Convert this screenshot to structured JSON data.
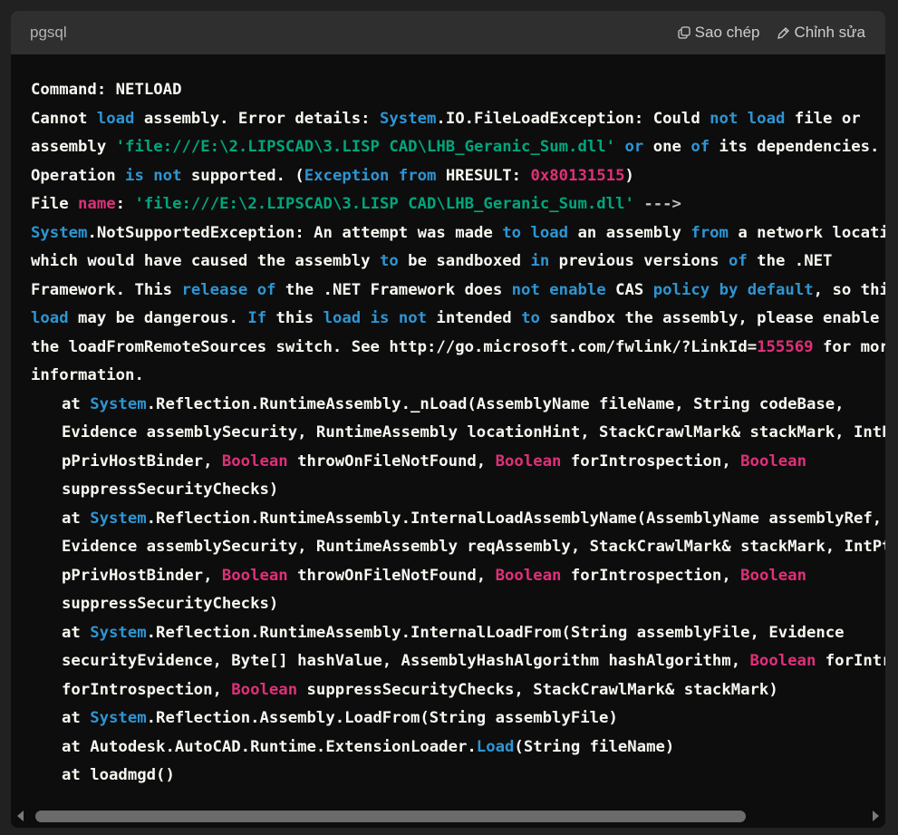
{
  "header": {
    "language": "pgsql",
    "copy_label": "Sao chép",
    "edit_label": "Chỉnh sửa"
  },
  "code_lines": [
    [
      [
        "p",
        "Command: NETLOAD"
      ]
    ],
    [
      [
        "p",
        "Cannot "
      ],
      [
        "kw",
        "load"
      ],
      [
        "p",
        " assembly. Error details: "
      ],
      [
        "kw",
        "System"
      ],
      [
        "p",
        ".IO.FileLoadException: Could "
      ],
      [
        "kw",
        "not"
      ],
      [
        "p",
        " "
      ],
      [
        "kw",
        "load"
      ],
      [
        "p",
        " file or"
      ]
    ],
    [
      [
        "p",
        "assembly "
      ],
      [
        "str",
        "'file:///E:\\2.LIPSCAD\\3.LISP CAD\\LHB_Geranic_Sum.dll'"
      ],
      [
        "p",
        " "
      ],
      [
        "kw",
        "or"
      ],
      [
        "p",
        " one "
      ],
      [
        "kw",
        "of"
      ],
      [
        "p",
        " its dependencies."
      ]
    ],
    [
      [
        "p",
        "Operation "
      ],
      [
        "kw",
        "is"
      ],
      [
        "p",
        " "
      ],
      [
        "kw",
        "not"
      ],
      [
        "p",
        " supported. ("
      ],
      [
        "kw",
        "Exception"
      ],
      [
        "p",
        " "
      ],
      [
        "kw",
        "from"
      ],
      [
        "p",
        " HRESULT: "
      ],
      [
        "num",
        "0x80131515"
      ],
      [
        "p",
        ")"
      ]
    ],
    [
      [
        "p",
        "File "
      ],
      [
        "typ",
        "name"
      ],
      [
        "p",
        ": "
      ],
      [
        "str",
        "'file:///E:\\2.LIPSCAD\\3.LISP CAD\\LHB_Geranic_Sum.dll'"
      ],
      [
        "p",
        " "
      ],
      [
        "op",
        "--->"
      ]
    ],
    [
      [
        "kw",
        "System"
      ],
      [
        "p",
        ".NotSupportedException: An attempt was made "
      ],
      [
        "kw",
        "to"
      ],
      [
        "p",
        " "
      ],
      [
        "kw",
        "load"
      ],
      [
        "p",
        " an assembly "
      ],
      [
        "kw",
        "from"
      ],
      [
        "p",
        " a network location"
      ]
    ],
    [
      [
        "p",
        "which would have caused the assembly "
      ],
      [
        "kw",
        "to"
      ],
      [
        "p",
        " be sandboxed "
      ],
      [
        "kw",
        "in"
      ],
      [
        "p",
        " previous versions "
      ],
      [
        "kw",
        "of"
      ],
      [
        "p",
        " the .NET"
      ]
    ],
    [
      [
        "p",
        "Framework. This "
      ],
      [
        "kw",
        "release"
      ],
      [
        "p",
        " "
      ],
      [
        "kw",
        "of"
      ],
      [
        "p",
        " the .NET Framework does "
      ],
      [
        "kw",
        "not"
      ],
      [
        "p",
        " "
      ],
      [
        "kw",
        "enable"
      ],
      [
        "p",
        " CAS "
      ],
      [
        "kw",
        "policy"
      ],
      [
        "p",
        " "
      ],
      [
        "kw",
        "by"
      ],
      [
        "p",
        " "
      ],
      [
        "kw",
        "default"
      ],
      [
        "p",
        ", so this"
      ]
    ],
    [
      [
        "kw",
        "load"
      ],
      [
        "p",
        " may be dangerous. "
      ],
      [
        "kw",
        "If"
      ],
      [
        "p",
        " this "
      ],
      [
        "kw",
        "load"
      ],
      [
        "p",
        " "
      ],
      [
        "kw",
        "is"
      ],
      [
        "p",
        " "
      ],
      [
        "kw",
        "not"
      ],
      [
        "p",
        " intended "
      ],
      [
        "kw",
        "to"
      ],
      [
        "p",
        " sandbox the assembly, please enable"
      ]
    ],
    [
      [
        "p",
        "the loadFromRemoteSources switch. See http://go.microsoft.com/fwlink/?LinkId="
      ],
      [
        "num",
        "155569"
      ],
      [
        "p",
        " for more"
      ]
    ],
    [
      [
        "p",
        "information."
      ]
    ],
    [
      [
        "i",
        ""
      ],
      [
        "p",
        "at "
      ],
      [
        "kw",
        "System"
      ],
      [
        "p",
        ".Reflection.RuntimeAssembly._nLoad(AssemblyName fileName, String codeBase,"
      ]
    ],
    [
      [
        "i",
        ""
      ],
      [
        "p",
        "Evidence assemblySecurity, RuntimeAssembly locationHint, StackCrawlMark& stackMark, IntPtr"
      ]
    ],
    [
      [
        "i",
        ""
      ],
      [
        "p",
        "pPrivHostBinder, "
      ],
      [
        "typ",
        "Boolean"
      ],
      [
        "p",
        " throwOnFileNotFound, "
      ],
      [
        "typ",
        "Boolean"
      ],
      [
        "p",
        " forIntrospection, "
      ],
      [
        "typ",
        "Boolean"
      ]
    ],
    [
      [
        "i",
        ""
      ],
      [
        "p",
        "suppressSecurityChecks)"
      ]
    ],
    [
      [
        "i",
        ""
      ],
      [
        "p",
        "at "
      ],
      [
        "kw",
        "System"
      ],
      [
        "p",
        ".Reflection.RuntimeAssembly.InternalLoadAssemblyName(AssemblyName assemblyRef,"
      ]
    ],
    [
      [
        "i",
        ""
      ],
      [
        "p",
        "Evidence assemblySecurity, RuntimeAssembly reqAssembly, StackCrawlMark& stackMark, IntPtr"
      ]
    ],
    [
      [
        "i",
        ""
      ],
      [
        "p",
        "pPrivHostBinder, "
      ],
      [
        "typ",
        "Boolean"
      ],
      [
        "p",
        " throwOnFileNotFound, "
      ],
      [
        "typ",
        "Boolean"
      ],
      [
        "p",
        " forIntrospection, "
      ],
      [
        "typ",
        "Boolean"
      ]
    ],
    [
      [
        "i",
        ""
      ],
      [
        "p",
        "suppressSecurityChecks)"
      ]
    ],
    [
      [
        "i",
        ""
      ],
      [
        "p",
        "at "
      ],
      [
        "kw",
        "System"
      ],
      [
        "p",
        ".Reflection.RuntimeAssembly.InternalLoadFrom(String assemblyFile, Evidence"
      ]
    ],
    [
      [
        "i",
        ""
      ],
      [
        "p",
        "securityEvidence, Byte[] hashValue, AssemblyHashAlgorithm hashAlgorithm, "
      ],
      [
        "typ",
        "Boolean"
      ],
      [
        "p",
        " forIntrospection"
      ]
    ],
    [
      [
        "i",
        ""
      ],
      [
        "p",
        "forIntrospection, "
      ],
      [
        "typ",
        "Boolean"
      ],
      [
        "p",
        " suppressSecurityChecks, StackCrawlMark& stackMark)"
      ]
    ],
    [
      [
        "i",
        ""
      ],
      [
        "p",
        "at "
      ],
      [
        "kw",
        "System"
      ],
      [
        "p",
        ".Reflection.Assembly.LoadFrom(String assemblyFile)"
      ]
    ],
    [
      [
        "i",
        ""
      ],
      [
        "p",
        "at Autodesk.AutoCAD.Runtime.ExtensionLoader."
      ],
      [
        "kw",
        "Load"
      ],
      [
        "p",
        "(String fileName)"
      ]
    ],
    [
      [
        "i",
        ""
      ],
      [
        "p",
        "at loadmgd()"
      ]
    ]
  ],
  "colors": {
    "keyword": "#2e95d3",
    "string": "#00a67d",
    "number": "#df3079",
    "plain": "#f8f8f2"
  }
}
